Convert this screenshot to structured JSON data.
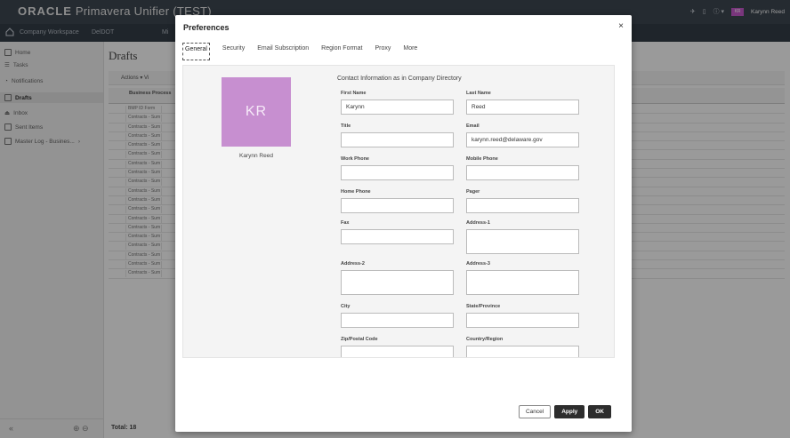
{
  "app": {
    "brand_logo": "ORACLE",
    "brand_product": "Primavera Unifier (TEST)",
    "user_initials": "KR",
    "user_name": "Karynn Reed"
  },
  "nav": {
    "items": [
      "Company Workspace",
      "DelDOT",
      "Mi"
    ]
  },
  "sidebar": {
    "items": [
      {
        "label": "Home",
        "icon": "folder-icon"
      },
      {
        "label": "Tasks",
        "icon": "tasks-icon"
      },
      {
        "label": "Notifications",
        "icon": "bell-icon"
      },
      {
        "label": "Drafts",
        "icon": "drafts-icon"
      },
      {
        "label": "Inbox",
        "icon": "inbox-icon"
      },
      {
        "label": "Sent Items",
        "icon": "sent-icon"
      },
      {
        "label": "Master Log - Busines...",
        "icon": "log-icon"
      }
    ],
    "bottom_left": "«",
    "bottom_right": "⊕ ⊖"
  },
  "main": {
    "title": "Drafts",
    "actions_label": "Actions ▾   Vi",
    "column_header": "Business Process",
    "rows": [
      "BMP ID Form",
      "Contracts - Sum",
      "Contracts - Sum",
      "Contracts - Sum",
      "Contracts - Sum",
      "Contracts - Sum",
      "Contracts - Sum",
      "Contracts - Sum",
      "Contracts - Sum",
      "Contracts - Sum",
      "Contracts - Sum",
      "Contracts - Sum",
      "Contracts - Sum",
      "Contracts - Sum",
      "Contracts - Sum",
      "Contracts - Sum",
      "Contracts - Sum",
      "Contracts - Sum",
      "Contracts - Sum"
    ],
    "total": "Total: 18"
  },
  "dialog": {
    "title": "Preferences",
    "close_glyph": "×",
    "tabs": [
      "General",
      "Security",
      "Email Subscription",
      "Region Format",
      "Proxy",
      "More"
    ],
    "active_tab": "General",
    "photo_initials": "KR",
    "photo_name": "Karynn Reed",
    "contact_heading": "Contact Information as in Company Directory",
    "fields": {
      "first_name": {
        "label": "First Name",
        "value": "Karynn"
      },
      "last_name": {
        "label": "Last Name",
        "value": "Reed"
      },
      "title": {
        "label": "Title",
        "value": ""
      },
      "email": {
        "label": "Email",
        "value": "karynn.reed@delaware.gov"
      },
      "work_phone": {
        "label": "Work Phone",
        "value": ""
      },
      "mobile_phone": {
        "label": "Mobile Phone",
        "value": ""
      },
      "home_phone": {
        "label": "Home Phone",
        "value": ""
      },
      "pager": {
        "label": "Pager",
        "value": ""
      },
      "fax": {
        "label": "Fax",
        "value": ""
      },
      "address_1": {
        "label": "Address-1",
        "value": ""
      },
      "address_2": {
        "label": "Address-2",
        "value": ""
      },
      "address_3": {
        "label": "Address-3",
        "value": ""
      },
      "city": {
        "label": "City",
        "value": ""
      },
      "state": {
        "label": "State/Province",
        "value": ""
      },
      "zip": {
        "label": "Zip/Postal Code",
        "value": ""
      },
      "country": {
        "label": "Country/Region",
        "value": ""
      }
    },
    "buttons": {
      "cancel": "Cancel",
      "apply": "Apply",
      "ok": "OK"
    }
  },
  "colors": {
    "topbar": "#2b3540",
    "avatar": "#c78fd0",
    "primary_button": "#2d2d2d"
  }
}
